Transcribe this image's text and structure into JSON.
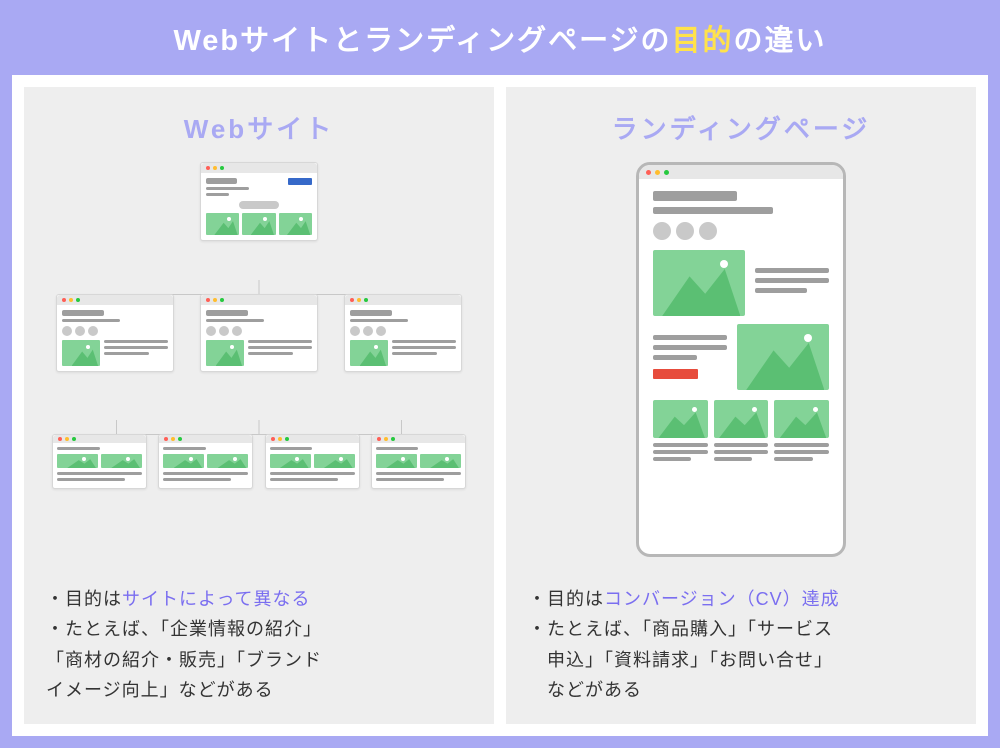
{
  "header": {
    "title_pre": "Webサイトとランディングページの",
    "title_accent": "目的",
    "title_post": "の違い"
  },
  "left": {
    "title": "Webサイト",
    "desc_line1_pre": "・目的は",
    "desc_line1_hl": "サイトによって異なる",
    "desc_line2": "・たとえば、「企業情報の紹介」",
    "desc_line3": "「商材の紹介・販売」「ブランド",
    "desc_line4": "イメージ向上」などがある"
  },
  "right": {
    "title": "ランディングページ",
    "desc_line1_pre": "・目的は",
    "desc_line1_hl": "コンバージョン（CV）達成",
    "desc_line2": "・たとえば、「商品購入」「サービス",
    "desc_line3": "　申込」「資料請求」「お問い合せ」",
    "desc_line4": "　などがある"
  }
}
